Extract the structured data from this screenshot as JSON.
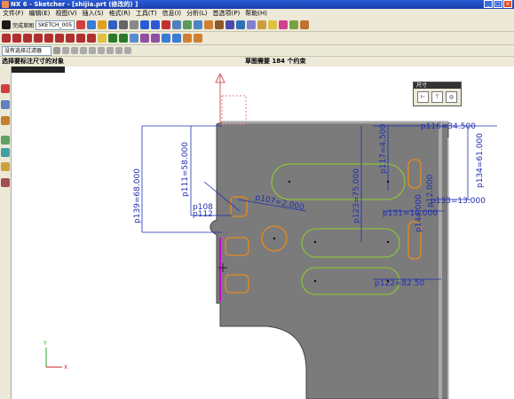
{
  "window": {
    "title": "NX 6 - Sketcher - [shijia.prt (修改的) ]",
    "min": "_",
    "max": "□",
    "close": "×"
  },
  "menu": [
    "文件(F)",
    "编辑(E)",
    "视图(V)",
    "插入(S)",
    "格式(R)",
    "工具(T)",
    "信息(I)",
    "分析(L)",
    "首选项(P)",
    "帮助(H)"
  ],
  "toolbar": {
    "finish_label": "完成草图",
    "sketch_name": "SKETCH_005"
  },
  "filter": {
    "value": "没有选择过滤器"
  },
  "status": {
    "prompt": "选择要标注尺寸的对象",
    "constraint": "草图需要 184 个约束"
  },
  "dim_palette": {
    "title": "尺寸"
  },
  "dimensions": {
    "d1": "p139=68.000",
    "d2": "p111=58.000",
    "d3": "p117=4.500",
    "d4": "p123=75.000",
    "d5": "p116=34.500",
    "d6": "p134=61.000",
    "d7": "p133=13.000",
    "d8": "p131=10.000",
    "d9": "p122=82.50",
    "d10": "p108",
    "d11": "p107=2.000",
    "d12": "p112",
    "d13": "p144.000",
    "d14": "p12.000"
  },
  "axes": {
    "x": "X",
    "y": "Y"
  },
  "colors": {
    "part": "#808080",
    "dimension": "#0000cc",
    "slot": "#8bbf3c",
    "circle": "#e8891f",
    "selected": "#cc00cc"
  }
}
